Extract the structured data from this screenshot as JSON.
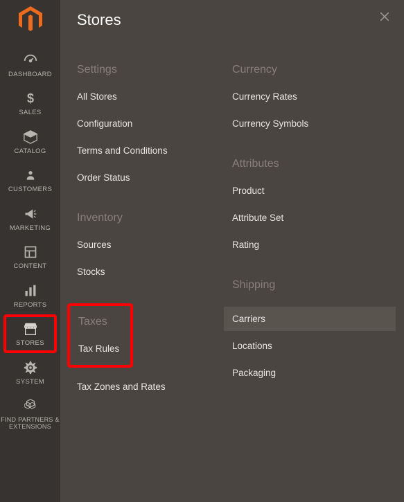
{
  "sidebar": {
    "items": [
      {
        "name": "dashboard",
        "label": "DASHBOARD"
      },
      {
        "name": "sales",
        "label": "SALES"
      },
      {
        "name": "catalog",
        "label": "CATALOG"
      },
      {
        "name": "customers",
        "label": "CUSTOMERS"
      },
      {
        "name": "marketing",
        "label": "MARKETING"
      },
      {
        "name": "content",
        "label": "CONTENT"
      },
      {
        "name": "reports",
        "label": "REPORTS"
      },
      {
        "name": "stores",
        "label": "STORES"
      },
      {
        "name": "system",
        "label": "SYSTEM"
      },
      {
        "name": "partners",
        "label": "FIND PARTNERS & EXTENSIONS"
      }
    ]
  },
  "panel": {
    "title": "Stores",
    "sections": {
      "settings": {
        "header": "Settings",
        "items": [
          "All Stores",
          "Configuration",
          "Terms and Conditions",
          "Order Status"
        ]
      },
      "inventory": {
        "header": "Inventory",
        "items": [
          "Sources",
          "Stocks"
        ]
      },
      "taxes": {
        "header": "Taxes",
        "items": [
          "Tax Rules",
          "Tax Zones and Rates"
        ]
      },
      "currency": {
        "header": "Currency",
        "items": [
          "Currency Rates",
          "Currency Symbols"
        ]
      },
      "attributes": {
        "header": "Attributes",
        "items": [
          "Product",
          "Attribute Set",
          "Rating"
        ]
      },
      "shipping": {
        "header": "Shipping",
        "items": [
          "Carriers",
          "Locations",
          "Packaging"
        ]
      }
    }
  }
}
